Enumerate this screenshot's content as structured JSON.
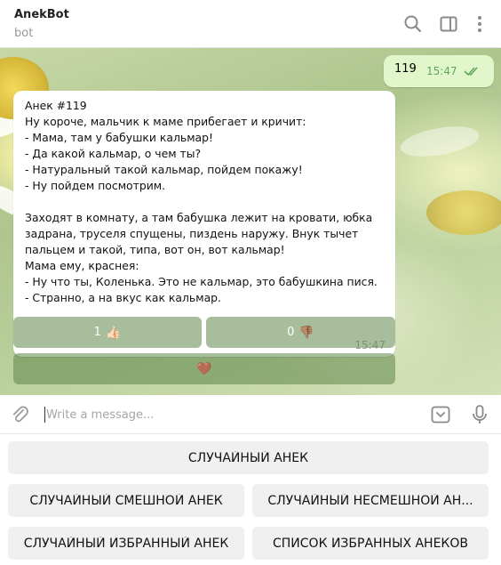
{
  "header": {
    "title": "AnekBot",
    "subtitle": "bot",
    "icons": [
      "search-icon",
      "sidebar-toggle-icon",
      "more-vertical-icon"
    ]
  },
  "outgoing_message": {
    "text": "119",
    "time": "15:47",
    "status": "read-double-check"
  },
  "incoming_message": {
    "lines": [
      "Анек #119",
      "Ну короче, мальчик к маме прибегает и кричит:",
      "- Мама, там у бабушки кальмар!",
      "- Да какой кальмар, о чем ты?",
      "- Натуральный такой кальмар, пойдем покажу!",
      "- Ну пойдем посмотрим.",
      "",
      "Заходят в комнату, а там бабушка лежит на кровати, юбка",
      "задрана, труселя спущены, пиздень наружу. Внук тычет",
      "пальцем и такой, типа, вот он, вот кальмар!",
      "Мама ему, краснея:",
      "- Ну что ты, Коленька. Это не кальмар, это бабушкина пися.",
      "- Странно, а на вкус как кальмар."
    ],
    "time": "15:47"
  },
  "inline_keyboard": {
    "like": {
      "count": "1",
      "emoji": "👍🏻"
    },
    "dislike": {
      "count": "0",
      "emoji": "👎🏽"
    },
    "favorite": {
      "emoji": "🤎"
    }
  },
  "composer": {
    "placeholder": "Write a message...",
    "value": ""
  },
  "reply_keyboard": {
    "random": "СЛУЧАЙНЫЙ АНЕК",
    "random_funny": "СЛУЧАЙНЫЙ СМЕШНОЙ АНЕК",
    "random_unfunny": "СЛУЧАЙНЫЙ НЕСМЕШНОЙ АН...",
    "random_favorite": "СЛУЧАЙНЫЙ ИЗБРАННЫЙ АНЕК",
    "favorites_list": "СПИСОК ИЗБРАННЫХ АНЕКОВ"
  },
  "colors": {
    "outgoing_bubble": "#e1f7cb",
    "accent_time": "#5fa85a",
    "inline_button": "#6b8f57"
  }
}
